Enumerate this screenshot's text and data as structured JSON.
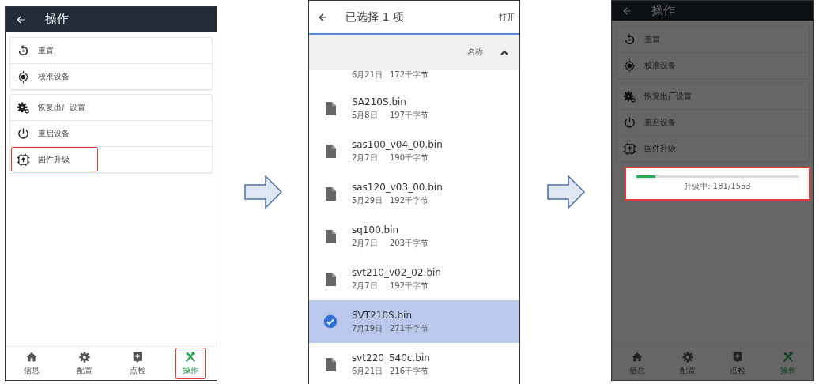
{
  "screens": [
    {
      "kind": "actions",
      "title": "操作",
      "dimmed": false,
      "groups": [
        {
          "items": [
            {
              "kind": "reset",
              "label": "重置",
              "highlighted": false
            },
            {
              "kind": "calibrate",
              "label": "校准设备",
              "highlighted": false
            }
          ]
        },
        {
          "items": [
            {
              "kind": "factory",
              "label": "恢复出厂设置",
              "highlighted": false
            },
            {
              "kind": "power",
              "label": "重启设备",
              "highlighted": false
            },
            {
              "kind": "firmware",
              "label": "固件升级",
              "highlighted": true
            }
          ]
        }
      ],
      "nav": [
        {
          "kind": "home",
          "label": "信息",
          "selected": false,
          "highlighted": false
        },
        {
          "kind": "gear",
          "label": "配置",
          "selected": false,
          "highlighted": false
        },
        {
          "kind": "check",
          "label": "点检",
          "selected": false,
          "highlighted": false
        },
        {
          "kind": "tools",
          "label": "操作",
          "selected": true,
          "highlighted": true
        }
      ]
    },
    {
      "kind": "picker",
      "title": "已选择 1 项",
      "action": "打开",
      "sort_label": "名称",
      "files": [
        {
          "date": "6月21日",
          "size": "172千字节",
          "selected": false
        },
        {
          "name": "SA210S.bin",
          "date": "5月8日",
          "size": "197千字节",
          "selected": false
        },
        {
          "name": "sas100_v04_00.bin",
          "date": "2月7日",
          "size": "190千字节",
          "selected": false
        },
        {
          "name": "sas120_v03_00.bin",
          "date": "5月29日",
          "size": "192千字节",
          "selected": false
        },
        {
          "name": "sq100.bin",
          "date": "2月7日",
          "size": "203千字节",
          "selected": false
        },
        {
          "name": "svt210_v02_02.bin",
          "date": "2月7日",
          "size": "192千字节",
          "selected": false
        },
        {
          "name": "SVT210S.bin",
          "date": "7月19日",
          "size": "271千字节",
          "selected": true
        },
        {
          "name": "svt220_540c.bin",
          "date": "6月21日",
          "size": "216千字节",
          "selected": false
        }
      ]
    },
    {
      "kind": "actions",
      "title": "操作",
      "dimmed": true,
      "groups": [
        {
          "items": [
            {
              "kind": "reset",
              "label": "重置",
              "highlighted": false
            },
            {
              "kind": "calibrate",
              "label": "校准设备",
              "highlighted": false
            }
          ]
        },
        {
          "items": [
            {
              "kind": "factory",
              "label": "恢复出厂设置",
              "highlighted": false
            },
            {
              "kind": "power",
              "label": "重启设备",
              "highlighted": false
            },
            {
              "kind": "firmware",
              "label": "固件升级",
              "highlighted": false
            }
          ]
        }
      ],
      "dialog": {
        "level": 0.117,
        "text": "升级中: 181/1553",
        "highlighted": true
      },
      "nav": [
        {
          "kind": "home",
          "label": "信息",
          "selected": false,
          "highlighted": false
        },
        {
          "kind": "gear",
          "label": "配置",
          "selected": false,
          "highlighted": false
        },
        {
          "kind": "check",
          "label": "点检",
          "selected": false,
          "highlighted": false
        },
        {
          "kind": "tools",
          "label": "操作",
          "selected": true,
          "highlighted": false
        }
      ]
    }
  ]
}
